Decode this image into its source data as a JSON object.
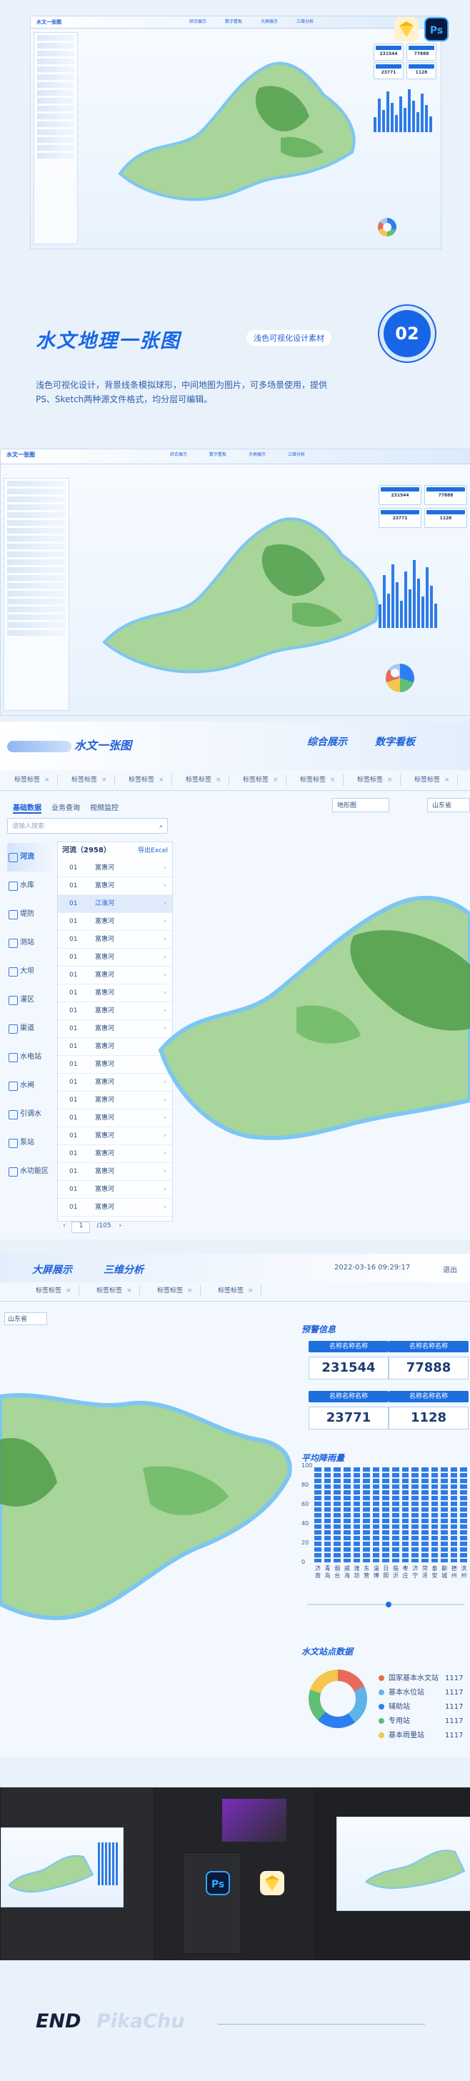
{
  "preview": {
    "logo": "水文一张图",
    "nav": [
      "综合展示",
      "数字看板",
      "大屏展示",
      "三维分析"
    ],
    "stats": [
      "231544",
      "77888",
      "23771",
      "1128"
    ]
  },
  "app_badges": {
    "sketch_icon": "sketch-icon",
    "ps": "Ps"
  },
  "section": {
    "title": "水文地理一张图",
    "subtitle": "浅色可视化设计素材",
    "number": "02",
    "description": "浅色可视化设计，背景线条模拟球形，中间地图为图片，可多场景使用，提供PS、Sketch两种源文件格式，均分层可编辑。"
  },
  "zoom1": {
    "logo": "水文一张图",
    "nav": [
      "综合展示",
      "数字看板"
    ],
    "tabs": [
      "标签标签",
      "标签标签",
      "标签标签",
      "标签标签",
      "标签标签",
      "标签标签",
      "标签标签",
      "标签标签"
    ],
    "subtabs": [
      "基础数据",
      "业务查询",
      "视频监控"
    ],
    "search_placeholder": "请输入搜索",
    "categories": [
      "河流",
      "水库",
      "堤防",
      "测站",
      "大坝",
      "灌区",
      "渠道",
      "水电站",
      "水闸",
      "引调水",
      "泵站",
      "水功能区"
    ],
    "list_header": "河流（2958）",
    "export": "导出Excel",
    "rows": [
      [
        "01",
        "富惠河"
      ],
      [
        "01",
        "富惠河"
      ],
      [
        "01",
        "江淮河"
      ],
      [
        "01",
        "富惠河"
      ],
      [
        "01",
        "富惠河"
      ],
      [
        "01",
        "富惠河"
      ],
      [
        "01",
        "富惠河"
      ],
      [
        "01",
        "富惠河"
      ],
      [
        "01",
        "富惠河"
      ],
      [
        "01",
        "富惠河"
      ],
      [
        "01",
        "富惠河"
      ],
      [
        "01",
        "富惠河"
      ],
      [
        "01",
        "富惠河"
      ],
      [
        "01",
        "富惠河"
      ],
      [
        "01",
        "富惠河"
      ],
      [
        "01",
        "富惠河"
      ],
      [
        "01",
        "富惠河"
      ],
      [
        "01",
        "富惠河"
      ],
      [
        "01",
        "富惠河"
      ],
      [
        "01",
        "富惠河"
      ]
    ],
    "pager": {
      "page": "1",
      "total": "/105"
    },
    "map_select": "地形图",
    "region_select": "山东省"
  },
  "zoom2": {
    "nav": [
      "大屏展示",
      "三维分析"
    ],
    "time": "2022-03-16 09:29:17",
    "logout": "退出",
    "region": "山东省",
    "panel_warning": "预警信息",
    "stats": [
      {
        "label": "名称名称名称",
        "value": "231544"
      },
      {
        "label": "名称名称名称",
        "value": "77888"
      },
      {
        "label": "名称名称名称",
        "value": "23771"
      },
      {
        "label": "名称名称名称",
        "value": "1128"
      }
    ],
    "panel_rain": "平均降雨量",
    "yaxis": [
      "100",
      "80",
      "60",
      "40",
      "20",
      "0"
    ],
    "cities": [
      "济南",
      "青岛",
      "烟台",
      "威海",
      "潍坊",
      "东营",
      "淄博",
      "日照",
      "临沂",
      "枣庄",
      "济宁",
      "菏泽",
      "泰安",
      "聊城",
      "德州",
      "滨州"
    ],
    "panel_station": "水文站点数据",
    "legend": [
      {
        "name": "国家基本水文站",
        "value": "1117",
        "color": "#e86a5a"
      },
      {
        "name": "基本水位站",
        "value": "1117",
        "color": "#5fb3e8"
      },
      {
        "name": "辅助站",
        "value": "1117",
        "color": "#2d7ef0"
      },
      {
        "name": "专用站",
        "value": "1117",
        "color": "#5fbf74"
      },
      {
        "name": "基本雨量站",
        "value": "1117",
        "color": "#f4c64d"
      }
    ]
  },
  "end": {
    "text": "END",
    "signature": "PikaChu"
  }
}
